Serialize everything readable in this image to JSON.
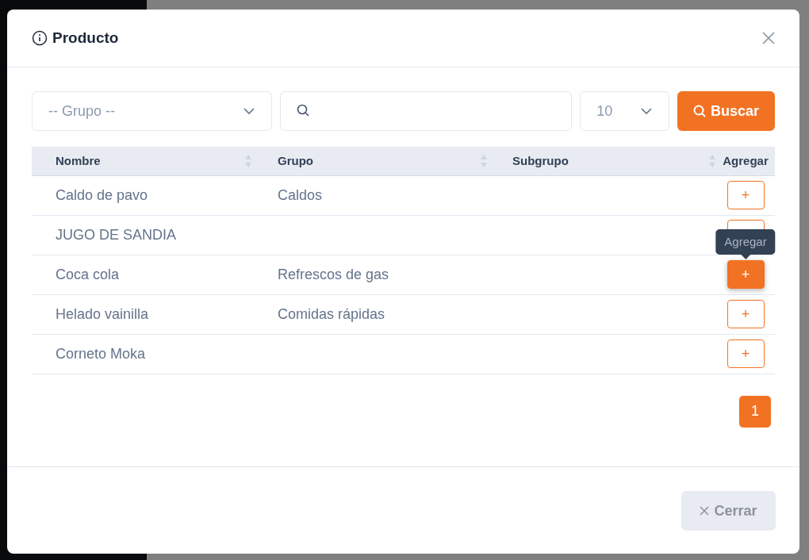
{
  "modal": {
    "title": "Producto",
    "filters": {
      "group_select": {
        "placeholder": "-- Grupo --"
      },
      "page_size": "10",
      "search_button": "Buscar"
    },
    "table": {
      "columns": [
        {
          "label": "Nombre",
          "sortable": true
        },
        {
          "label": "Grupo",
          "sortable": true
        },
        {
          "label": "Subgrupo",
          "sortable": true
        },
        {
          "label": "Agregar",
          "sortable": false
        }
      ],
      "rows": [
        {
          "nombre": "Caldo de pavo",
          "grupo": "Caldos",
          "add": "+",
          "highlighted": false
        },
        {
          "nombre": "JUGO DE SANDIA",
          "highlighted": false
        },
        {
          "nombre": "Coca cola",
          "grupo": "Refrescos de gas",
          "add": "+",
          "highlighted": true,
          "tooltip": "Agregar"
        },
        {
          "nombre": "Helado vainilla",
          "grupo": "Comidas rápidas",
          "add": "+",
          "highlighted": false
        },
        {
          "nombre": "Corneto Moka",
          "add": "+",
          "highlighted": false
        }
      ]
    },
    "pagination": [
      {
        "label": "1",
        "selected": true
      }
    ],
    "close_button": "Cerrar"
  }
}
